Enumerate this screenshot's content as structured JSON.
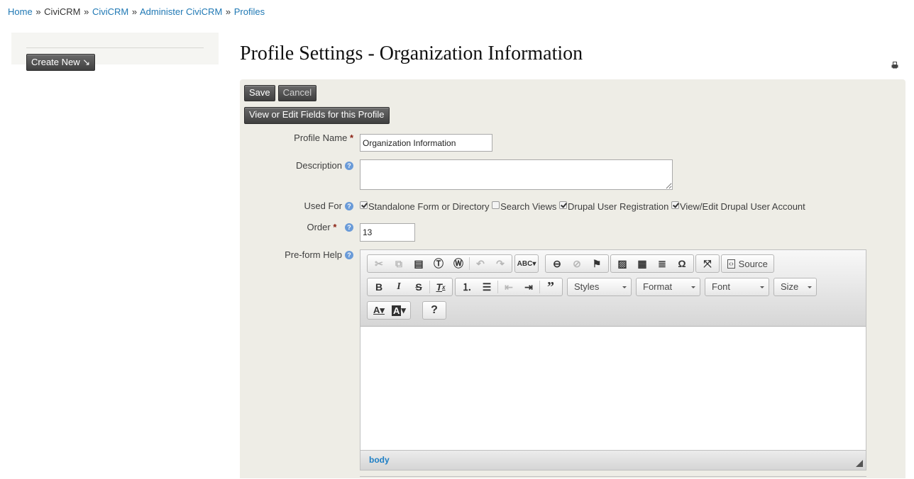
{
  "breadcrumb": {
    "items": [
      {
        "label": "Home",
        "link": true
      },
      {
        "label": "CiviCRM",
        "link": false
      },
      {
        "label": "CiviCRM",
        "link": true
      },
      {
        "label": "Administer CiviCRM",
        "link": true
      },
      {
        "label": "Profiles",
        "link": true
      }
    ],
    "separator": "»"
  },
  "sidebar": {
    "create_new_label": "Create New ↘"
  },
  "page": {
    "title": "Profile Settings - Organization Information",
    "print_icon": "printer-icon"
  },
  "actions": {
    "save_label": "Save",
    "cancel_label": "Cancel",
    "view_edit_label": "View or Edit Fields for this Profile"
  },
  "form": {
    "profile_name": {
      "label": "Profile Name",
      "required_mark": "*",
      "value": "Organization Information"
    },
    "description": {
      "label": "Description",
      "value": ""
    },
    "used_for": {
      "label": "Used For",
      "options": [
        {
          "label": "Standalone Form or Directory",
          "checked": true
        },
        {
          "label": "Search Views",
          "checked": false
        },
        {
          "label": "Drupal User Registration",
          "checked": true
        },
        {
          "label": "View/Edit Drupal User Account",
          "checked": true
        }
      ]
    },
    "order": {
      "label": "Order",
      "required_mark": "*",
      "value": "13"
    },
    "pre_form_help": {
      "label": "Pre-form Help"
    }
  },
  "editor": {
    "source_label": "Source",
    "combos": {
      "styles": "Styles",
      "format": "Format",
      "font": "Font",
      "size": "Size"
    },
    "help_label": "?",
    "status_path": "body"
  },
  "colors": {
    "link": "#1f78b4",
    "panel_bg": "#eeede6",
    "required": "#8a1f11",
    "help_icon": "#6a9bd8"
  }
}
